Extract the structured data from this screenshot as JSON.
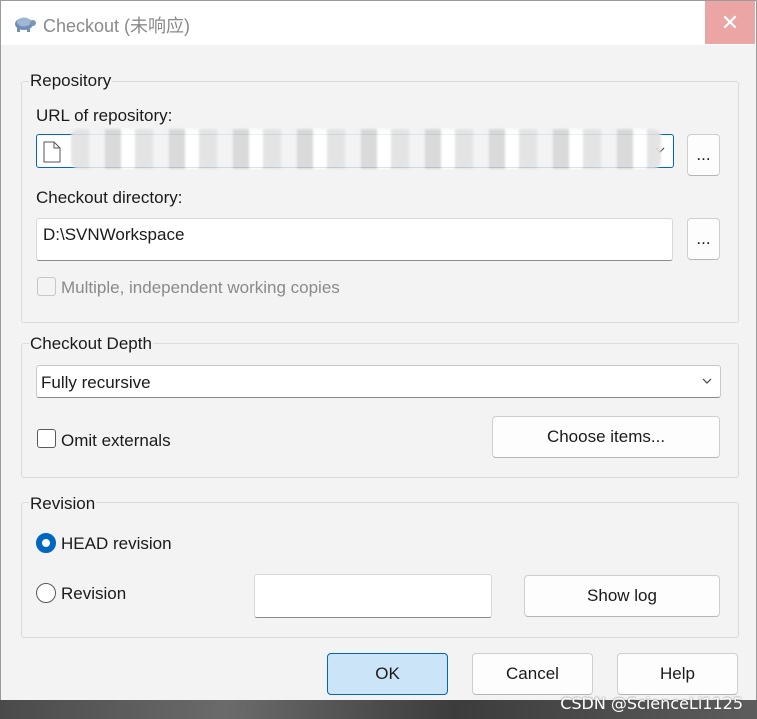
{
  "window": {
    "title": "Checkout (未响应)",
    "close_glyph": "✕"
  },
  "repository": {
    "group_label": "Repository",
    "url_label": "URL of repository:",
    "url_value": "",
    "browse_label": "...",
    "dir_label": "Checkout directory:",
    "dir_value": "D:\\SVNWorkspace",
    "dir_browse_label": "...",
    "multiple_copies_label": "Multiple, independent working copies",
    "multiple_copies_checked": false
  },
  "depth": {
    "group_label": "Checkout Depth",
    "selected": "Fully recursive",
    "omit_externals_label": "Omit externals",
    "omit_externals_checked": false,
    "choose_items_label": "Choose items..."
  },
  "revision": {
    "group_label": "Revision",
    "head_label": "HEAD revision",
    "head_checked": true,
    "revision_label": "Revision",
    "revision_value": "",
    "show_log_label": "Show log"
  },
  "footer": {
    "ok_label": "OK",
    "cancel_label": "Cancel",
    "help_label": "Help"
  },
  "watermark": "CSDN @ScienceLi1125",
  "colors": {
    "accent": "#0067c0",
    "close_bg": "#eba5a5"
  }
}
